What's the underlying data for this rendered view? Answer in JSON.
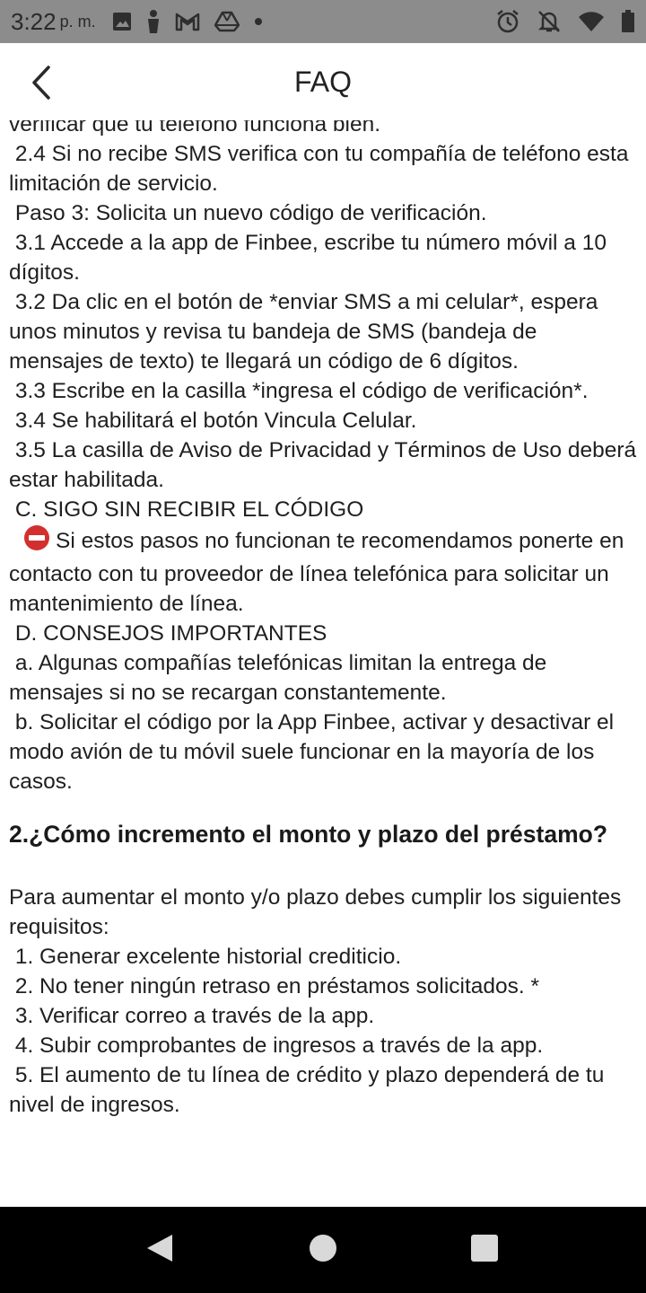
{
  "status_bar": {
    "time": "3:22",
    "ampm": "p. m.",
    "left_icons": [
      "image-icon",
      "person-icon",
      "gmail-icon",
      "drive-icon",
      "dot-icon"
    ],
    "right_icons": [
      "alarm-icon",
      "notifications-off-icon",
      "wifi-icon",
      "battery-icon"
    ]
  },
  "header": {
    "title": "FAQ",
    "back_icon": "chevron-left-icon"
  },
  "content": {
    "lines": [
      "verificar que tu teléfono funciona bien.",
      " 2.4 Si no recibe SMS verifica con tu compañía de teléfono esta limitación de servicio.",
      " Paso 3: Solicita un nuevo código de verificación.",
      " 3.1 Accede a la app de Finbee, escribe tu número móvil a 10 dígitos.",
      " 3.2 Da clic en el botón de *enviar SMS a mi celular*, espera unos minutos y revisa tu bandeja de SMS (bandeja de mensajes de texto) te llegará un código de 6 dígitos.",
      " 3.3 Escribe en la casilla *ingresa el código de verificación*.",
      " 3.4 Se habilitará el botón Vincula Celular.",
      " 3.5 La casilla de Aviso de Privacidad y Términos de Uso deberá estar habilitada.",
      " C. SIGO SIN RECIBIR EL CÓDIGO"
    ],
    "warning_text": "Si estos pasos no funcionan te recomendamos ponerte en contacto con tu proveedor de línea telefónica para solicitar un mantenimiento de línea.",
    "lines_after": [
      " D. CONSEJOS IMPORTANTES",
      " a. Algunas compañías telefónicas limitan la entrega de mensajes si no se recargan constantemente.",
      " b. Solicitar el código por la App Finbee, activar y desactivar el modo avión de tu móvil suele funcionar en la mayoría de los casos."
    ],
    "question_2": "2.¿Cómo incremento el monto y plazo del préstamo?",
    "answer_2_intro": "Para aumentar el monto y/o plazo debes cumplir los siguientes requisitos:",
    "answer_2_items": [
      " 1. Generar excelente historial crediticio.",
      " 2. No tener ningún retraso en préstamos solicitados. *",
      " 3. Verificar correo a través de la app.",
      " 4. Subir comprobantes de ingresos a través de la app.",
      " 5. El aumento de tu línea de crédito y plazo dependerá de tu nivel de ingresos."
    ]
  },
  "nav_bar": {
    "back": "nav-back-icon",
    "home": "nav-home-icon",
    "recents": "nav-recents-icon"
  },
  "colors": {
    "status_bar_bg": "#8c8c8c",
    "stop_red": "#d32f2f",
    "nav_bar_bg": "#000000"
  }
}
